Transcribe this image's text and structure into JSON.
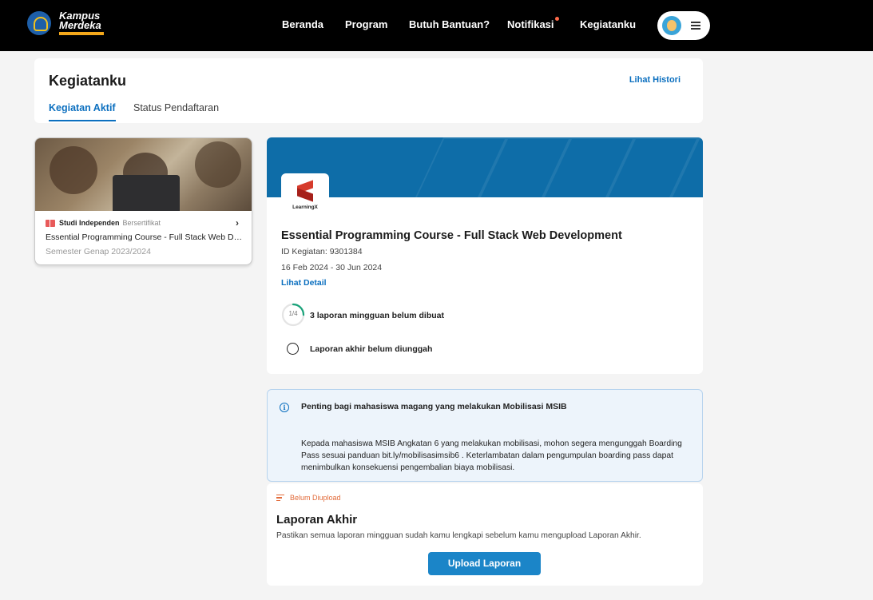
{
  "header": {
    "logo": {
      "line1": "Kampus",
      "line2": "Merdeka",
      "tagline": "INDONESIA JAYA"
    },
    "nav": [
      {
        "label": "Beranda",
        "has_dot": false
      },
      {
        "label": "Program",
        "has_dot": false
      },
      {
        "label": "Butuh Bantuan?",
        "has_dot": false
      },
      {
        "label": "Notifikasi",
        "has_dot": true
      },
      {
        "label": "Kegiatanku",
        "has_dot": false
      }
    ],
    "notification_dot_color": "#ff6a4a"
  },
  "page": {
    "title": "Kegiatanku",
    "history_link": "Lihat Histori",
    "tabs": [
      {
        "label": "Kegiatan Aktif",
        "active": true
      },
      {
        "label": "Status Pendaftaran",
        "active": false
      }
    ]
  },
  "activity_card": {
    "type": "Studi Independen",
    "badge": "Bersertifikat",
    "name": "Essential Programming Course - Full Stack Web Development",
    "semester": "Semester Genap 2023/2024"
  },
  "detail": {
    "partner": "LearningX",
    "title": "Essential Programming Course - Full Stack Web Development",
    "id_text": "ID Kegiatan: 9301384",
    "date_range": "16 Feb 2024 - 30 Jun 2024",
    "detail_link": "Lihat Detail",
    "weekly_progress": {
      "label": "1/4",
      "done": 1,
      "total": 4,
      "color": "#1aa37a"
    },
    "weekly_text": "3 laporan mingguan belum dibuat",
    "final_text": "Laporan akhir belum diunggah"
  },
  "info": {
    "title": "Penting bagi mahasiswa magang yang melakukan Mobilisasi MSIB",
    "body": "Kepada mahasiswa MSIB Angkatan 6 yang melakukan mobilisasi, mohon segera mengunggah Boarding Pass sesuai panduan bit.ly/mobilisasimsib6 . Keterlambatan dalam pengumpulan boarding pass dapat menimbulkan konsekuensi pengembalian biaya mobilisasi."
  },
  "final_report": {
    "status": "Belum Diupload",
    "title": "Laporan Akhir",
    "description": "Pastikan semua laporan mingguan sudah kamu lengkapi sebelum kamu mengupload Laporan Akhir.",
    "button_label": "Upload Laporan"
  },
  "colors": {
    "accent": "#0b6fbf",
    "banner": "#0e6da8",
    "button": "#1b85c8",
    "warning": "#e26b3a"
  }
}
